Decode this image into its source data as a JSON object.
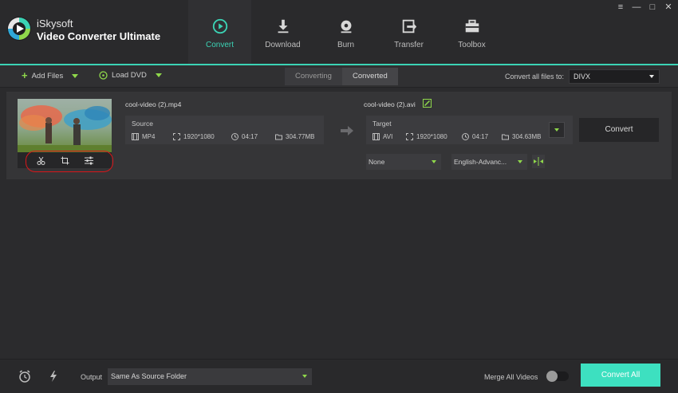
{
  "app": {
    "brand_line1": "iSkysoft",
    "brand_line2": "Video Converter Ultimate"
  },
  "window_controls": [
    "≡",
    "—",
    "□",
    "✕"
  ],
  "main_tabs": [
    {
      "label": "Convert",
      "icon": "convert-icon",
      "active": true
    },
    {
      "label": "Download",
      "icon": "download-icon",
      "active": false
    },
    {
      "label": "Burn",
      "icon": "burn-icon",
      "active": false
    },
    {
      "label": "Transfer",
      "icon": "transfer-icon",
      "active": false
    },
    {
      "label": "Toolbox",
      "icon": "toolbox-icon",
      "active": false
    }
  ],
  "toolbar": {
    "add_files": "Add Files",
    "load_dvd": "Load DVD",
    "tab_converting": "Converting",
    "tab_converted": "Converted",
    "convert_all_to_label": "Convert all files to:",
    "convert_all_to_value": "DIVX"
  },
  "file": {
    "source_name": "cool-video (2).mp4",
    "target_name": "cool-video (2).avi",
    "source": {
      "label": "Source",
      "format": "MP4",
      "resolution": "1920*1080",
      "duration": "04:17",
      "size": "304.77MB"
    },
    "target": {
      "label": "Target",
      "format": "AVI",
      "resolution": "1920*1080",
      "duration": "04:17",
      "size": "304.63MB"
    },
    "subtitle": "None",
    "audio": "English-Advanc...",
    "convert_label": "Convert"
  },
  "bottom": {
    "output_label": "Output",
    "output_value": "Same As Source Folder",
    "merge_label": "Merge All Videos",
    "merge_on": false,
    "convert_all_label": "Convert All"
  },
  "colors": {
    "accent": "#3bd3b5",
    "green": "#8fd84b",
    "highlight": "#d9161a"
  }
}
